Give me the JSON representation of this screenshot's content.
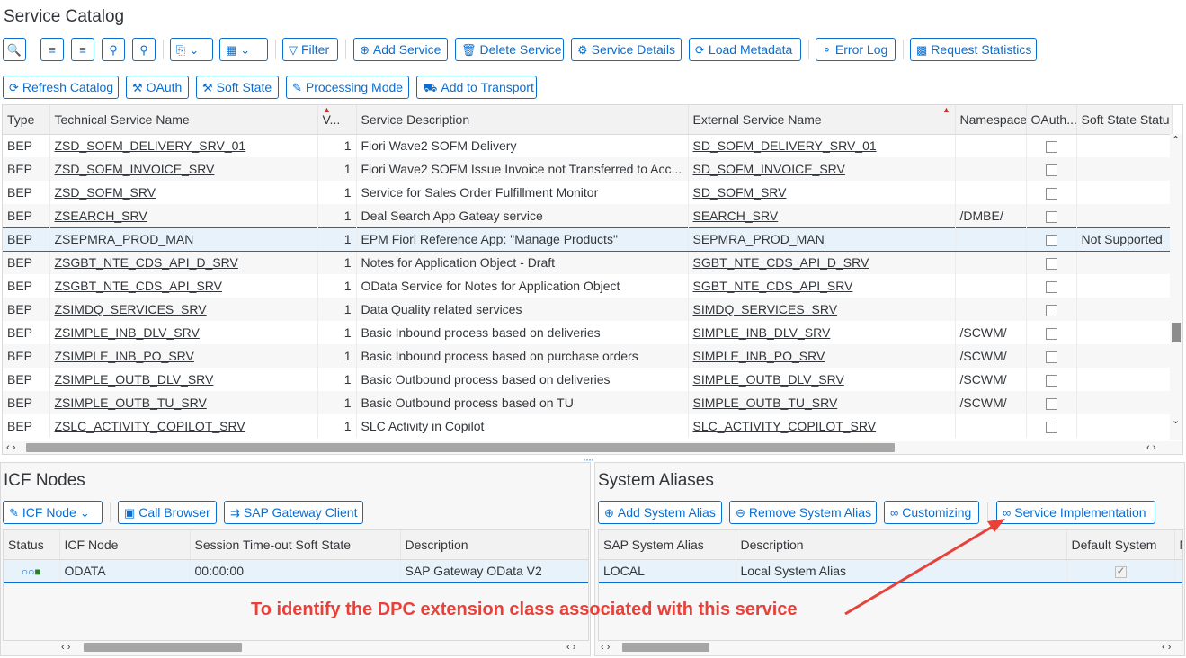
{
  "title": "Service Catalog",
  "toolbar1": {
    "filter": "Filter",
    "add_service": "Add Service",
    "delete_service": "Delete Service",
    "service_details": "Service Details",
    "load_metadata": "Load Metadata",
    "error_log": "Error Log",
    "request_statistics": "Request Statistics"
  },
  "toolbar2": {
    "refresh_catalog": "Refresh Catalog",
    "oauth": "OAuth",
    "soft_state": "Soft State",
    "processing_mode": "Processing Mode",
    "add_to_transport": "Add to Transport"
  },
  "catalog": {
    "columns": [
      "Type",
      "Technical Service Name",
      "V...",
      "Service Description",
      "External Service Name",
      "Namespace",
      "OAuth...",
      "Soft State Statu"
    ],
    "rows": [
      {
        "type": "BEP",
        "tech": "ZSD_SOFM_DELIVERY_SRV_01",
        "v": "1",
        "desc": "Fiori Wave2 SOFM Delivery",
        "ext": "SD_SOFM_DELIVERY_SRV_01",
        "ns": "",
        "soft": ""
      },
      {
        "type": "BEP",
        "tech": "ZSD_SOFM_INVOICE_SRV",
        "v": "1",
        "desc": "Fiori Wave2 SOFM Issue Invoice not Transferred to Acc...",
        "ext": "SD_SOFM_INVOICE_SRV",
        "ns": "",
        "soft": ""
      },
      {
        "type": "BEP",
        "tech": "ZSD_SOFM_SRV",
        "v": "1",
        "desc": "Service for Sales Order Fulfillment Monitor",
        "ext": "SD_SOFM_SRV",
        "ns": "",
        "soft": ""
      },
      {
        "type": "BEP",
        "tech": "ZSEARCH_SRV",
        "v": "1",
        "desc": "Deal Search App Gateay service",
        "ext": "SEARCH_SRV",
        "ns": "/DMBE/",
        "soft": ""
      },
      {
        "type": "BEP",
        "tech": "ZSEPMRA_PROD_MAN",
        "v": "1",
        "desc": "EPM Fiori Reference App: \"Manage Products\"",
        "ext": "SEPMRA_PROD_MAN",
        "ns": "",
        "soft": "Not Supported"
      },
      {
        "type": "BEP",
        "tech": "ZSGBT_NTE_CDS_API_D_SRV",
        "v": "1",
        "desc": "Notes for Application Object - Draft",
        "ext": "SGBT_NTE_CDS_API_D_SRV",
        "ns": "",
        "soft": ""
      },
      {
        "type": "BEP",
        "tech": "ZSGBT_NTE_CDS_API_SRV",
        "v": "1",
        "desc": "OData Service for Notes for Application Object",
        "ext": "SGBT_NTE_CDS_API_SRV",
        "ns": "",
        "soft": ""
      },
      {
        "type": "BEP",
        "tech": "ZSIMDQ_SERVICES_SRV",
        "v": "1",
        "desc": "Data Quality related services",
        "ext": "SIMDQ_SERVICES_SRV",
        "ns": "",
        "soft": ""
      },
      {
        "type": "BEP",
        "tech": "ZSIMPLE_INB_DLV_SRV",
        "v": "1",
        "desc": "Basic Inbound process based on deliveries",
        "ext": "SIMPLE_INB_DLV_SRV",
        "ns": "/SCWM/",
        "soft": ""
      },
      {
        "type": "BEP",
        "tech": "ZSIMPLE_INB_PO_SRV",
        "v": "1",
        "desc": "Basic Inbound process based on purchase orders",
        "ext": "SIMPLE_INB_PO_SRV",
        "ns": "/SCWM/",
        "soft": ""
      },
      {
        "type": "BEP",
        "tech": "ZSIMPLE_OUTB_DLV_SRV",
        "v": "1",
        "desc": "Basic Outbound process based on deliveries",
        "ext": "SIMPLE_OUTB_DLV_SRV",
        "ns": "/SCWM/",
        "soft": ""
      },
      {
        "type": "BEP",
        "tech": "ZSIMPLE_OUTB_TU_SRV",
        "v": "1",
        "desc": "Basic Outbound process based on TU",
        "ext": "SIMPLE_OUTB_TU_SRV",
        "ns": "/SCWM/",
        "soft": ""
      },
      {
        "type": "BEP",
        "tech": "ZSLC_ACTIVITY_COPILOT_SRV",
        "v": "1",
        "desc": "SLC Activity in Copilot",
        "ext": "SLC_ACTIVITY_COPILOT_SRV",
        "ns": "",
        "soft": ""
      }
    ]
  },
  "icf": {
    "title": "ICF Nodes",
    "icf_node_button": "ICF Node",
    "call_browser": "Call Browser",
    "gateway_client": "SAP Gateway Client",
    "columns": [
      "Status",
      "ICF Node",
      "Session Time-out Soft State",
      "Description"
    ],
    "row": {
      "node": "ODATA",
      "timeout": "00:00:00",
      "desc": "SAP Gateway OData V2"
    }
  },
  "aliases": {
    "title": "System Aliases",
    "add_alias": "Add System Alias",
    "remove_alias": "Remove System Alias",
    "customizing": "Customizing",
    "service_implementation": "Service Implementation",
    "columns": [
      "SAP System Alias",
      "Description",
      "Default System",
      "M"
    ],
    "row": {
      "alias": "LOCAL",
      "desc": "Local System Alias"
    }
  },
  "annotation": "To identify the DPC extension class associated with this service",
  "colors": {
    "accent": "#0a6ed1",
    "annotation": "#e8413a"
  }
}
